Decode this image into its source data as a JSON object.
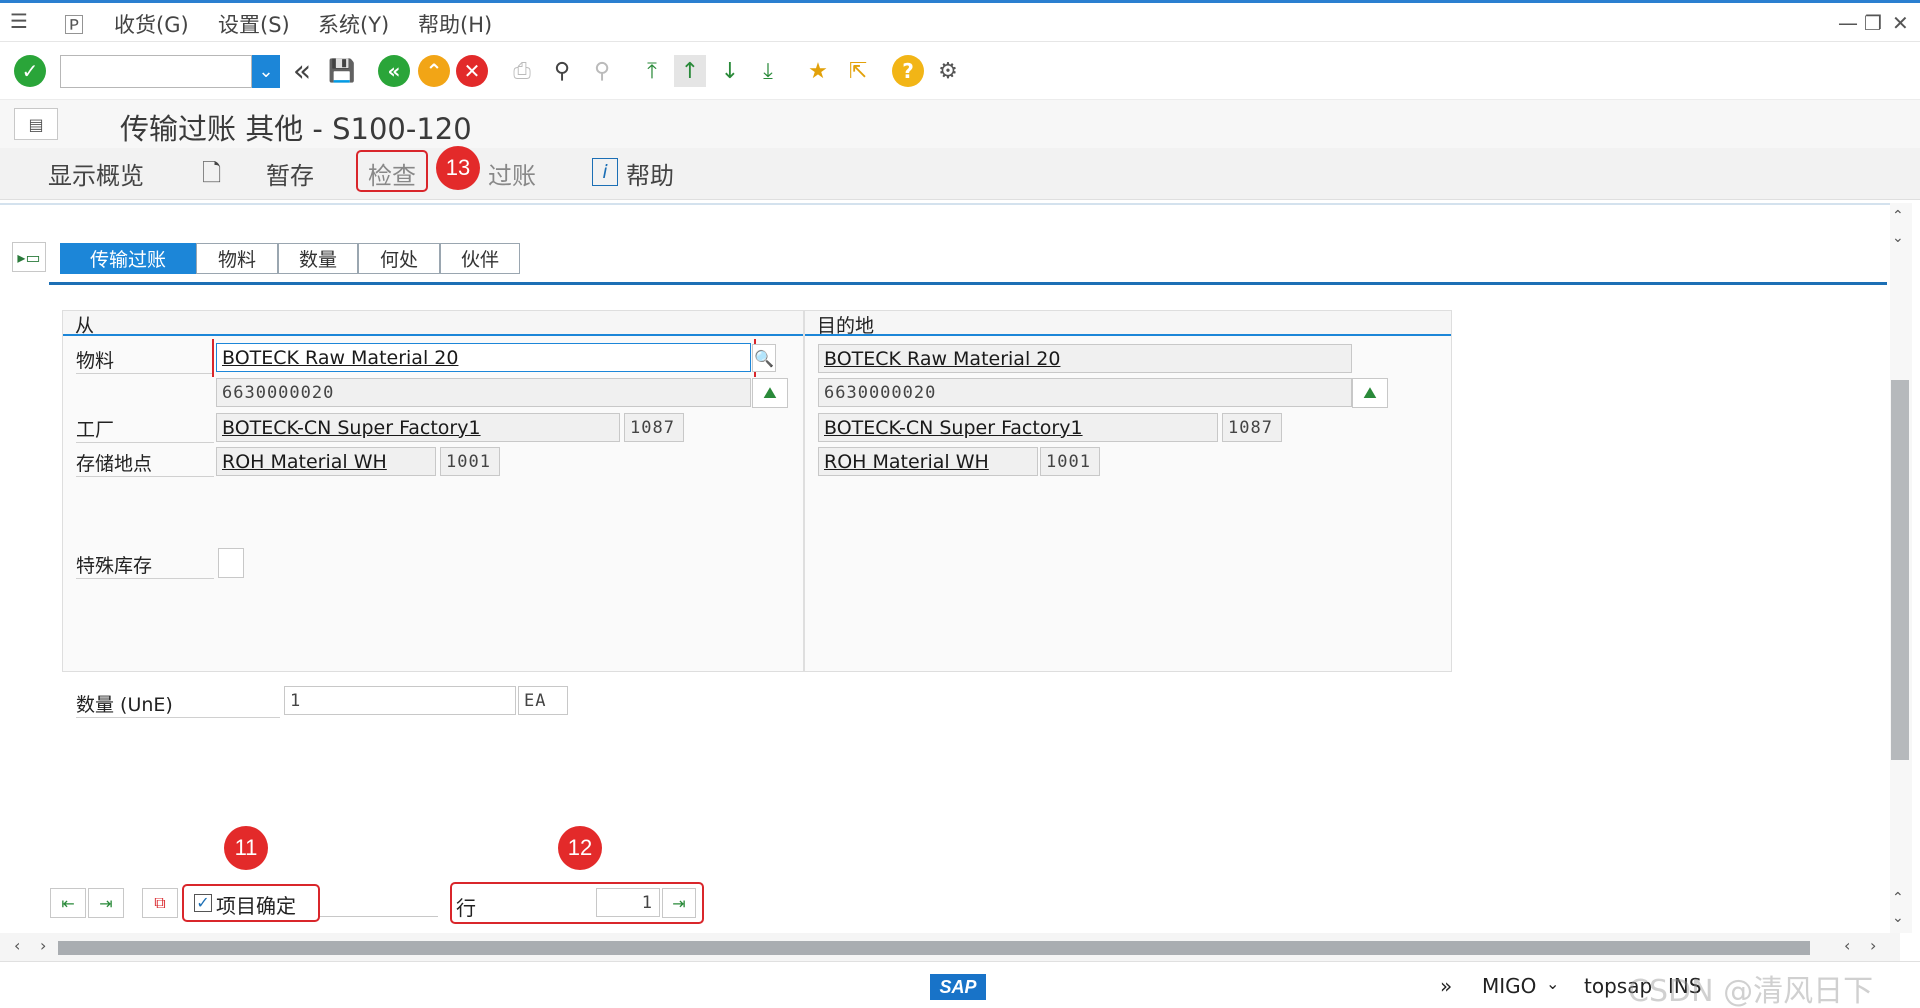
{
  "menubar": {
    "items": [
      "收货(G)",
      "设置(S)",
      "系统(Y)",
      "帮助(H)"
    ],
    "window_controls": [
      "—",
      "❐",
      "✕"
    ]
  },
  "toolbar": {
    "command_field_value": "",
    "icons": [
      "check-icon",
      "double-left-icon",
      "save-icon",
      "back-icon",
      "exit-icon",
      "cancel-icon",
      "print-icon",
      "find-icon",
      "find-next-icon",
      "first-page-icon",
      "prev-page-icon",
      "next-page-icon",
      "last-page-icon",
      "create-session-icon",
      "shortcut-icon",
      "help-icon",
      "settings-icon"
    ]
  },
  "title": "传输过账 其他 - S100-120",
  "app_toolbar": {
    "show_overview": "显示概览",
    "hold": "暂存",
    "check": "检查",
    "post": "过账",
    "help": "帮助"
  },
  "tabs": [
    "传输过账",
    "物料",
    "数量",
    "何处",
    "伙伴"
  ],
  "from_panel": {
    "header": "从",
    "material_label": "物料",
    "material_desc": "BOTECK Raw Material 20",
    "material_no": "6630000020",
    "plant_label": "工厂",
    "plant_desc": "BOTECK-CN Super Factory1",
    "plant_code": "1087",
    "sloc_label": "存储地点",
    "sloc_desc": "ROH Material WH",
    "sloc_code": "1001",
    "special_stock_label": "特殊库存"
  },
  "to_panel": {
    "header": "目的地",
    "material_desc": "BOTECK Raw Material 20",
    "material_no": "6630000020",
    "plant_desc": "BOTECK-CN Super Factory1",
    "plant_code": "1087",
    "sloc_desc": "ROH Material WH",
    "sloc_code": "1001"
  },
  "quantity": {
    "label": "数量 (UnE)",
    "value": "1",
    "unit": "EA"
  },
  "item_ok": {
    "label": "项目确定",
    "checked": true
  },
  "line": {
    "label": "行",
    "value": "1"
  },
  "badges": {
    "b11": "11",
    "b12": "12",
    "b13": "13"
  },
  "statusbar": {
    "logo": "SAP",
    "transaction": "MIGO",
    "server": "topsap",
    "mode": "INS",
    "watermark": "CSDN @清风日下"
  },
  "colors": {
    "accent": "#1c86d8",
    "badge": "#e32a2a",
    "highlight_box": "#d9262b"
  }
}
